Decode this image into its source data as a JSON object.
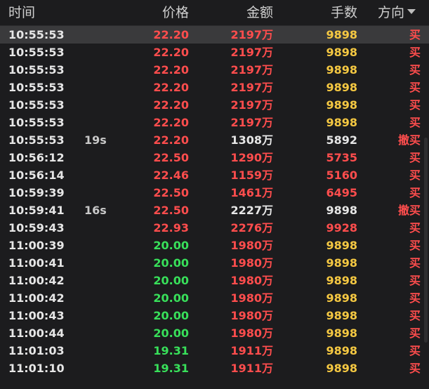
{
  "header": {
    "time": "时间",
    "price": "价格",
    "amount": "金额",
    "volume": "手数",
    "direction": "方向"
  },
  "rows": [
    {
      "time": "10:55:53",
      "tag": "",
      "price": "22.20",
      "price_color": "red",
      "amount": "2197万",
      "amount_color": "red",
      "volume": "9898",
      "volume_color": "yellow",
      "direction": "买"
    },
    {
      "time": "10:55:53",
      "tag": "",
      "price": "22.20",
      "price_color": "red",
      "amount": "2197万",
      "amount_color": "red",
      "volume": "9898",
      "volume_color": "yellow",
      "direction": "买"
    },
    {
      "time": "10:55:53",
      "tag": "",
      "price": "22.20",
      "price_color": "red",
      "amount": "2197万",
      "amount_color": "red",
      "volume": "9898",
      "volume_color": "yellow",
      "direction": "买"
    },
    {
      "time": "10:55:53",
      "tag": "",
      "price": "22.20",
      "price_color": "red",
      "amount": "2197万",
      "amount_color": "red",
      "volume": "9898",
      "volume_color": "yellow",
      "direction": "买"
    },
    {
      "time": "10:55:53",
      "tag": "",
      "price": "22.20",
      "price_color": "red",
      "amount": "2197万",
      "amount_color": "red",
      "volume": "9898",
      "volume_color": "yellow",
      "direction": "买"
    },
    {
      "time": "10:55:53",
      "tag": "",
      "price": "22.20",
      "price_color": "red",
      "amount": "2197万",
      "amount_color": "red",
      "volume": "9898",
      "volume_color": "yellow",
      "direction": "买"
    },
    {
      "time": "10:55:53",
      "tag": "19s",
      "price": "22.20",
      "price_color": "red",
      "amount": "1308万",
      "amount_color": "white",
      "volume": "5892",
      "volume_color": "white",
      "direction": "撤买"
    },
    {
      "time": "10:56:12",
      "tag": "",
      "price": "22.50",
      "price_color": "red",
      "amount": "1290万",
      "amount_color": "red",
      "volume": "5735",
      "volume_color": "red",
      "direction": "买"
    },
    {
      "time": "10:56:14",
      "tag": "",
      "price": "22.46",
      "price_color": "red",
      "amount": "1159万",
      "amount_color": "red",
      "volume": "5160",
      "volume_color": "red",
      "direction": "买"
    },
    {
      "time": "10:59:39",
      "tag": "",
      "price": "22.50",
      "price_color": "red",
      "amount": "1461万",
      "amount_color": "red",
      "volume": "6495",
      "volume_color": "red",
      "direction": "买"
    },
    {
      "time": "10:59:41",
      "tag": "16s",
      "price": "22.50",
      "price_color": "red",
      "amount": "2227万",
      "amount_color": "white",
      "volume": "9898",
      "volume_color": "white",
      "direction": "撤买"
    },
    {
      "time": "10:59:43",
      "tag": "",
      "price": "22.93",
      "price_color": "red",
      "amount": "2276万",
      "amount_color": "red",
      "volume": "9928",
      "volume_color": "red",
      "direction": "买"
    },
    {
      "time": "11:00:39",
      "tag": "",
      "price": "20.00",
      "price_color": "green",
      "amount": "1980万",
      "amount_color": "red",
      "volume": "9898",
      "volume_color": "yellow",
      "direction": "买"
    },
    {
      "time": "11:00:41",
      "tag": "",
      "price": "20.00",
      "price_color": "green",
      "amount": "1980万",
      "amount_color": "red",
      "volume": "9898",
      "volume_color": "yellow",
      "direction": "买"
    },
    {
      "time": "11:00:42",
      "tag": "",
      "price": "20.00",
      "price_color": "green",
      "amount": "1980万",
      "amount_color": "red",
      "volume": "9898",
      "volume_color": "yellow",
      "direction": "买"
    },
    {
      "time": "11:00:42",
      "tag": "",
      "price": "20.00",
      "price_color": "green",
      "amount": "1980万",
      "amount_color": "red",
      "volume": "9898",
      "volume_color": "yellow",
      "direction": "买"
    },
    {
      "time": "11:00:43",
      "tag": "",
      "price": "20.00",
      "price_color": "green",
      "amount": "1980万",
      "amount_color": "red",
      "volume": "9898",
      "volume_color": "yellow",
      "direction": "买"
    },
    {
      "time": "11:00:44",
      "tag": "",
      "price": "20.00",
      "price_color": "green",
      "amount": "1980万",
      "amount_color": "red",
      "volume": "9898",
      "volume_color": "yellow",
      "direction": "买"
    },
    {
      "time": "11:01:03",
      "tag": "",
      "price": "19.31",
      "price_color": "green",
      "amount": "1911万",
      "amount_color": "red",
      "volume": "9898",
      "volume_color": "yellow",
      "direction": "买"
    },
    {
      "time": "11:01:10",
      "tag": "",
      "price": "19.31",
      "price_color": "green",
      "amount": "1911万",
      "amount_color": "red",
      "volume": "9898",
      "volume_color": "yellow",
      "direction": "买"
    }
  ],
  "colors": {
    "background": "#1c1c1e",
    "selected_row": "#3a3a3c",
    "red": "#ff4d4d",
    "green": "#38e05a",
    "yellow": "#f5c842",
    "white": "#e6e6e6"
  }
}
